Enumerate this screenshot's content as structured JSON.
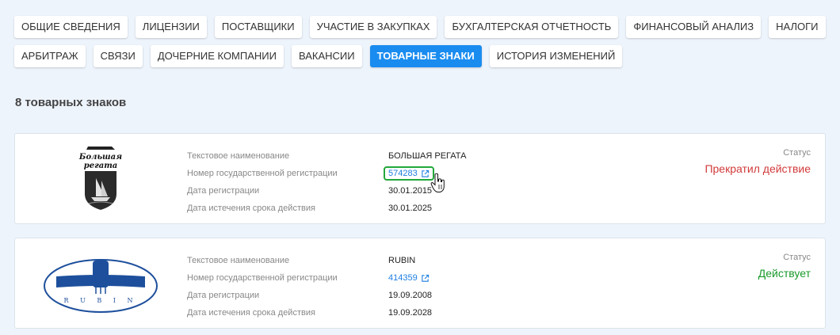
{
  "tabs": [
    {
      "label": "ОБЩИЕ СВЕДЕНИЯ",
      "active": false
    },
    {
      "label": "ЛИЦЕНЗИИ",
      "active": false
    },
    {
      "label": "ПОСТАВЩИКИ",
      "active": false
    },
    {
      "label": "УЧАСТИЕ В ЗАКУПКАХ",
      "active": false
    },
    {
      "label": "БУХГАЛТЕРСКАЯ ОТЧЕТНОСТЬ",
      "active": false
    },
    {
      "label": "ФИНАНСОВЫЙ АНАЛИЗ",
      "active": false
    },
    {
      "label": "НАЛОГИ",
      "active": false
    },
    {
      "label": "АРБИТРАЖ",
      "active": false
    },
    {
      "label": "СВЯЗИ",
      "active": false
    },
    {
      "label": "ДОЧЕРНИЕ КОМПАНИИ",
      "active": false
    },
    {
      "label": "ВАКАНСИИ",
      "active": false
    },
    {
      "label": "ТОВАРНЫЕ ЗНАКИ",
      "active": true
    },
    {
      "label": "ИСТОРИЯ ИЗМЕНЕНИЙ",
      "active": false
    }
  ],
  "summary": {
    "count_title": "8 товарных знаков"
  },
  "field_labels": {
    "name": "Текстовое наименование",
    "reg_number": "Номер государственной регистрации",
    "reg_date": "Дата регистрации",
    "expiry_date": "Дата истечения срока действия",
    "status": "Статус"
  },
  "trademarks": [
    {
      "logo_text_line1": "Большая",
      "logo_text_line2": "регата",
      "name": "БОЛЬШАЯ РЕГАТА",
      "reg_number": "574283",
      "reg_date": "30.01.2015",
      "expiry_date": "30.01.2025",
      "status": "Прекратил действие",
      "status_color": "#d23a3a"
    },
    {
      "logo_text": "R U B I N",
      "name": "RUBIN",
      "reg_number": "414359",
      "reg_date": "19.09.2008",
      "expiry_date": "19.09.2028",
      "status": "Действует",
      "status_color": "#1a9a2a"
    }
  ],
  "colors": {
    "accent": "#1a8cf0",
    "link": "#1f7fe0",
    "highlight": "#22a83a"
  }
}
